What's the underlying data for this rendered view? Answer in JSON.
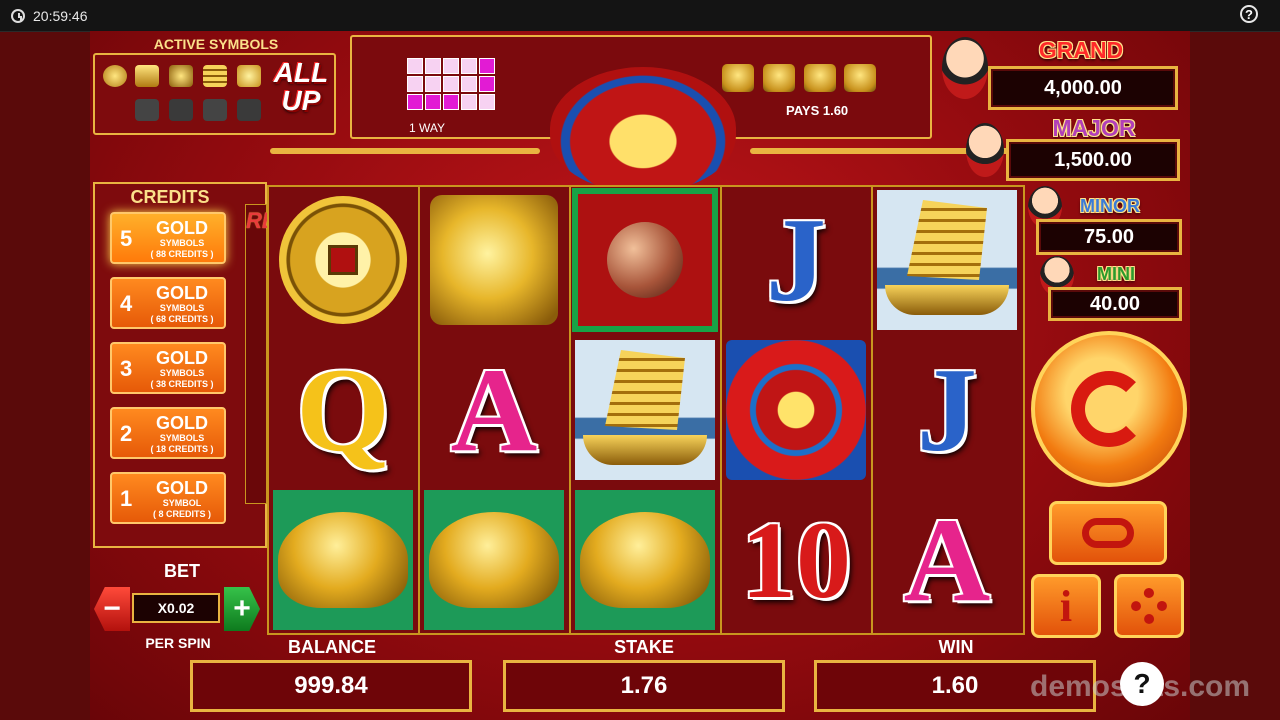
{
  "topbar": {
    "time": "20:59:46",
    "help_icon": "?"
  },
  "active_symbols": {
    "title": "ACTIVE SYMBOLS",
    "badge": "ALL UP"
  },
  "pays_panel": {
    "way_label": "1 WAY",
    "pays_label": "PAYS 1.60"
  },
  "jackpots": {
    "grand": {
      "label": "GRAND",
      "value": "4,000.00"
    },
    "major": {
      "label": "MAJOR",
      "value": "1,500.00"
    },
    "minor": {
      "label": "MINOR",
      "value": "75.00"
    },
    "mini": {
      "label": "MINI",
      "value": "40.00"
    }
  },
  "credits": {
    "title": "CREDITS",
    "options": [
      {
        "num": "5",
        "gold": "GOLD",
        "symbols": "SYMBOLS",
        "credits": "( 88 CREDITS )",
        "selected": true
      },
      {
        "num": "4",
        "gold": "GOLD",
        "symbols": "SYMBOLS",
        "credits": "( 68 CREDITS )",
        "selected": false
      },
      {
        "num": "3",
        "gold": "GOLD",
        "symbols": "SYMBOLS",
        "credits": "( 38 CREDITS )",
        "selected": false
      },
      {
        "num": "2",
        "gold": "GOLD",
        "symbols": "SYMBOLS",
        "credits": "( 18 CREDITS )",
        "selected": false
      },
      {
        "num": "1",
        "gold": "GOLD",
        "symbols": "SYMBOL",
        "credits": "( 8 CREDITS )",
        "selected": false
      }
    ],
    "reel_ways": "REELWAYS"
  },
  "bet": {
    "label": "BET",
    "value": "X0.02",
    "minus": "−",
    "plus": "+",
    "per_spin": "PER SPIN"
  },
  "reels": [
    [
      "coin",
      "phoenix",
      "gong",
      "J",
      "ship"
    ],
    [
      "Q",
      "A",
      "ship",
      "fu",
      "J"
    ],
    [
      "turtle",
      "turtle",
      "turtle",
      "10",
      "A"
    ]
  ],
  "card_colors": {
    "J": "#2a63c9",
    "Q": "#f5c21a",
    "A": "#e6248c",
    "10": "#d81a1a"
  },
  "bottom": {
    "balance_label": "BALANCE",
    "balance": "999.84",
    "stake_label": "STAKE",
    "stake": "1.76",
    "win_label": "WIN",
    "win": "1.60"
  },
  "watermark": "demoslots.com",
  "buttons": {
    "info": "i",
    "autoplay_icon": "autoplay-icon",
    "settings_icon": "gear-icon",
    "spin_icon": "spin-icon"
  }
}
